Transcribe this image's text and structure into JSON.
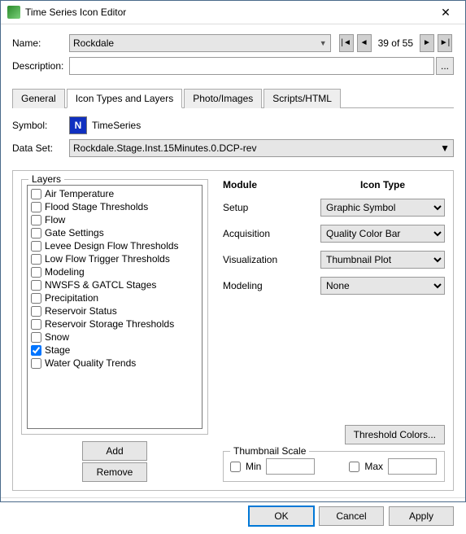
{
  "window": {
    "title": "Time Series Icon Editor"
  },
  "form": {
    "name_label": "Name:",
    "name_value": "Rockdale",
    "nav": {
      "first": "|◄",
      "prev": "◄",
      "counter": "39 of 55",
      "next": "►",
      "last": "►|"
    },
    "desc_label": "Description:",
    "desc_value": "",
    "dots": "..."
  },
  "tabs": {
    "general": "General",
    "icon_types": "Icon Types and Layers",
    "photo": "Photo/Images",
    "scripts": "Scripts/HTML"
  },
  "symbol": {
    "label": "Symbol:",
    "icon_letter": "N",
    "text": "TimeSeries"
  },
  "dataset": {
    "label": "Data Set:",
    "value": "Rockdale.Stage.Inst.15Minutes.0.DCP-rev"
  },
  "layers": {
    "legend": "Layers",
    "items": [
      {
        "label": "Air Temperature",
        "checked": false
      },
      {
        "label": "Flood Stage Thresholds",
        "checked": false
      },
      {
        "label": "Flow",
        "checked": false
      },
      {
        "label": "Gate Settings",
        "checked": false
      },
      {
        "label": "Levee Design Flow Thresholds",
        "checked": false
      },
      {
        "label": "Low Flow Trigger Thresholds",
        "checked": false
      },
      {
        "label": "Modeling",
        "checked": false
      },
      {
        "label": "NWSFS & GATCL Stages",
        "checked": false
      },
      {
        "label": "Precipitation",
        "checked": false
      },
      {
        "label": "Reservoir Status",
        "checked": false
      },
      {
        "label": "Reservoir Storage Thresholds",
        "checked": false
      },
      {
        "label": "Snow",
        "checked": false
      },
      {
        "label": "Stage",
        "checked": true
      },
      {
        "label": "Water Quality Trends",
        "checked": false
      }
    ],
    "add": "Add",
    "remove": "Remove"
  },
  "modules": {
    "head_module": "Module",
    "head_icon": "Icon Type",
    "rows": [
      {
        "label": "Setup",
        "value": "Graphic Symbol"
      },
      {
        "label": "Acquisition",
        "value": "Quality Color Bar"
      },
      {
        "label": "Visualization",
        "value": "Thumbnail Plot"
      },
      {
        "label": "Modeling",
        "value": "None"
      }
    ],
    "threshold": "Threshold Colors..."
  },
  "thumb": {
    "legend": "Thumbnail Scale",
    "min": "Min",
    "max": "Max",
    "min_val": "",
    "max_val": ""
  },
  "buttons": {
    "ok": "OK",
    "cancel": "Cancel",
    "apply": "Apply"
  }
}
